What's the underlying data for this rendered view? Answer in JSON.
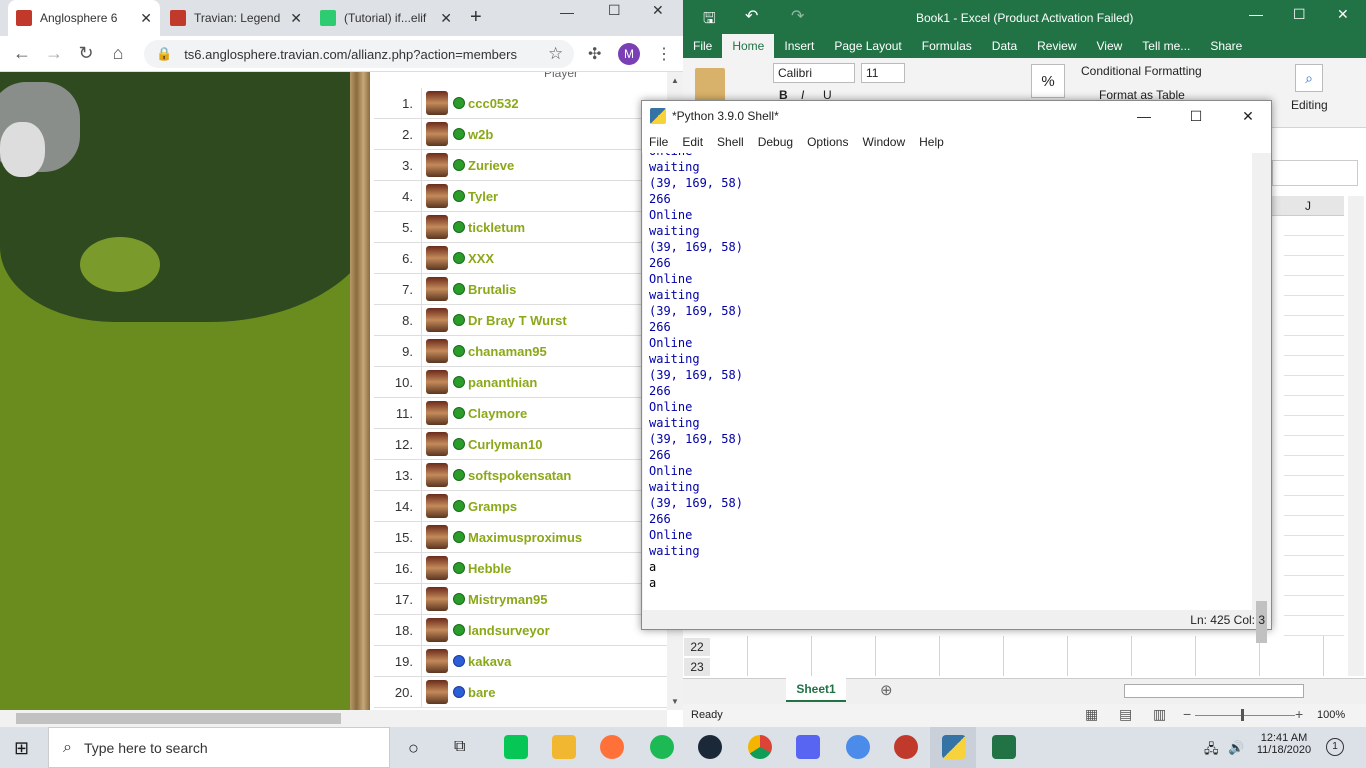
{
  "browser": {
    "tabs": [
      {
        "label": "Anglosphere 6",
        "icon_color": "#c0392b"
      },
      {
        "label": "Travian: Legend",
        "icon_color": "#c0392b"
      },
      {
        "label": "(Tutorial) if...elif",
        "icon_color": "#2ecc71"
      }
    ],
    "url": "ts6.anglosphere.travian.com/allianz.php?action=members",
    "profile_initial": "M"
  },
  "members": {
    "column_header": "Player",
    "rows": [
      {
        "rank": "1.",
        "name": "ccc0532",
        "status": "green"
      },
      {
        "rank": "2.",
        "name": "w2b",
        "status": "green"
      },
      {
        "rank": "3.",
        "name": "Zurieve",
        "status": "green"
      },
      {
        "rank": "4.",
        "name": "Tyler",
        "status": "green"
      },
      {
        "rank": "5.",
        "name": "tickletum",
        "status": "green"
      },
      {
        "rank": "6.",
        "name": "XXX",
        "status": "green"
      },
      {
        "rank": "7.",
        "name": "Brutalis",
        "status": "green"
      },
      {
        "rank": "8.",
        "name": "Dr Bray T Wurst",
        "status": "green"
      },
      {
        "rank": "9.",
        "name": "chanaman95",
        "status": "green"
      },
      {
        "rank": "10.",
        "name": "pananthian",
        "status": "green"
      },
      {
        "rank": "11.",
        "name": "Claymore",
        "status": "green"
      },
      {
        "rank": "12.",
        "name": "Curlyman10",
        "status": "green"
      },
      {
        "rank": "13.",
        "name": "softspokensatan",
        "status": "green"
      },
      {
        "rank": "14.",
        "name": "Gramps",
        "status": "green"
      },
      {
        "rank": "15.",
        "name": "Maximusproximus",
        "status": "green"
      },
      {
        "rank": "16.",
        "name": "Hebble",
        "status": "green"
      },
      {
        "rank": "17.",
        "name": "Mistryman95",
        "status": "green"
      },
      {
        "rank": "18.",
        "name": "landsurveyor",
        "status": "green"
      },
      {
        "rank": "19.",
        "name": "kakava",
        "status": "blue"
      },
      {
        "rank": "20.",
        "name": "bare",
        "status": "blue"
      }
    ]
  },
  "excel": {
    "title": "Book1 - Excel (Product Activation Failed)",
    "tabs": [
      "File",
      "Home",
      "Insert",
      "Page Layout",
      "Formulas",
      "Data",
      "Review",
      "View",
      "Tell me...",
      "Share"
    ],
    "font_name": "Calibri",
    "font_size": "11",
    "percent_symbol": "%",
    "conditional_formatting": "Conditional Formatting",
    "format_as_table": "Format as Table",
    "editing": "Editing",
    "column_j": "J",
    "rows_visible": [
      "22",
      "23"
    ],
    "sheet_tab": "Sheet1",
    "status_ready": "Ready",
    "zoom": "100%"
  },
  "python_shell": {
    "title": "*Python 3.9.0 Shell*",
    "menu": [
      "File",
      "Edit",
      "Shell",
      "Debug",
      "Options",
      "Window",
      "Help"
    ],
    "lines": [
      {
        "text": "Online",
        "type": "out"
      },
      {
        "text": "waiting",
        "type": "out"
      },
      {
        "text": "(39, 169, 58)",
        "type": "out"
      },
      {
        "text": "266",
        "type": "out"
      },
      {
        "text": "Online",
        "type": "out"
      },
      {
        "text": "waiting",
        "type": "out"
      },
      {
        "text": "(39, 169, 58)",
        "type": "out"
      },
      {
        "text": "266",
        "type": "out"
      },
      {
        "text": "Online",
        "type": "out"
      },
      {
        "text": "waiting",
        "type": "out"
      },
      {
        "text": "(39, 169, 58)",
        "type": "out"
      },
      {
        "text": "266",
        "type": "out"
      },
      {
        "text": "Online",
        "type": "out"
      },
      {
        "text": "waiting",
        "type": "out"
      },
      {
        "text": "(39, 169, 58)",
        "type": "out"
      },
      {
        "text": "266",
        "type": "out"
      },
      {
        "text": "Online",
        "type": "out"
      },
      {
        "text": "waiting",
        "type": "out"
      },
      {
        "text": "(39, 169, 58)",
        "type": "out"
      },
      {
        "text": "266",
        "type": "out"
      },
      {
        "text": "Online",
        "type": "out"
      },
      {
        "text": "waiting",
        "type": "out"
      },
      {
        "text": "(39, 169, 58)",
        "type": "out"
      },
      {
        "text": "266",
        "type": "out"
      },
      {
        "text": "Online",
        "type": "out"
      },
      {
        "text": "waiting",
        "type": "out"
      },
      {
        "text": "a",
        "type": "in"
      },
      {
        "text": "a",
        "type": "in"
      }
    ],
    "status": "Ln: 425   Col: 3"
  },
  "taskbar": {
    "search_placeholder": "Type here to search",
    "time": "12:41 AM",
    "date": "11/18/2020",
    "notification_count": "1"
  }
}
